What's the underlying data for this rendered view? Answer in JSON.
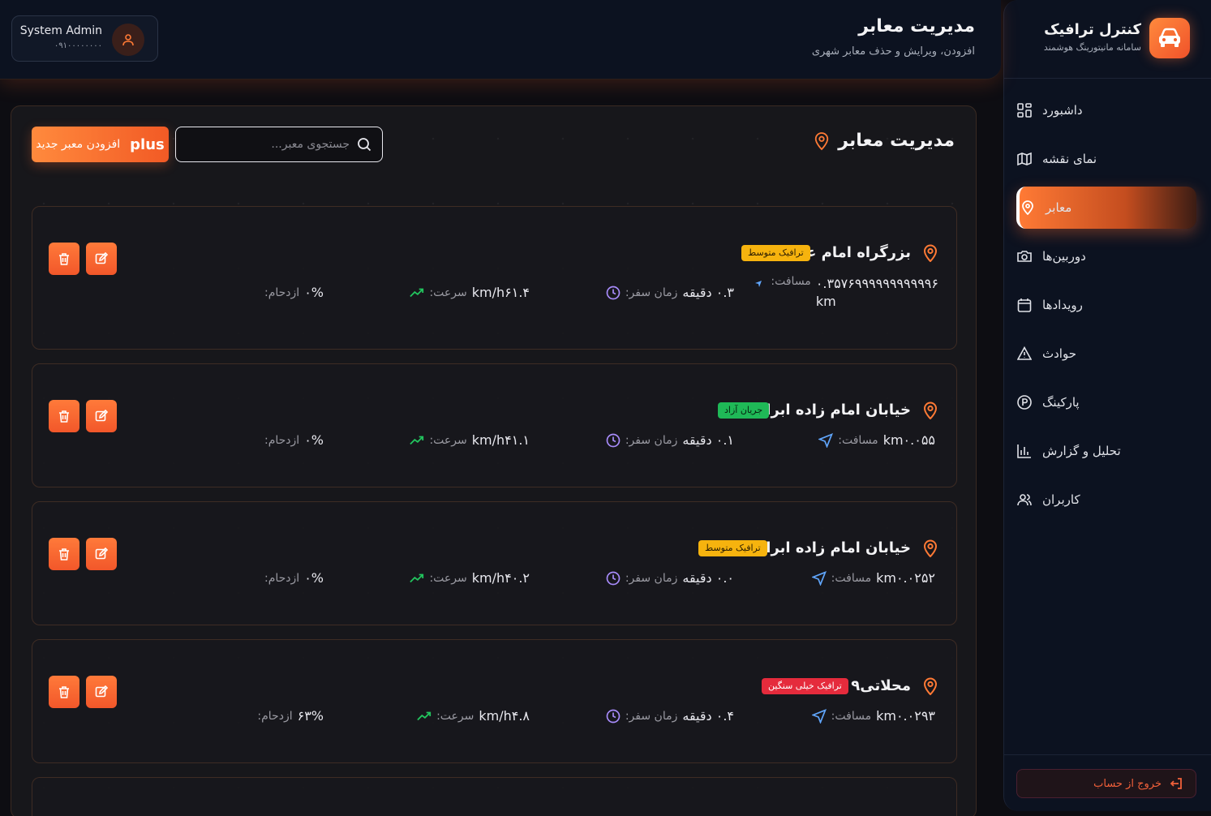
{
  "brand": {
    "title": "کنترل ترافیک",
    "subtitle": "سامانه مانیتورینگ هوشمند"
  },
  "nav": {
    "items": [
      {
        "label": "داشبورد",
        "icon": "dashboard-icon"
      },
      {
        "label": "نمای نقشه",
        "icon": "map-icon"
      },
      {
        "label": "معابر",
        "icon": "map-pin-icon",
        "active": true
      },
      {
        "label": "دوربین‌ها",
        "icon": "camera-icon"
      },
      {
        "label": "رویدادها",
        "icon": "calendar-icon"
      },
      {
        "label": "حوادث",
        "icon": "warning-icon"
      },
      {
        "label": "پارکینگ",
        "icon": "parking-icon"
      },
      {
        "label": "تحلیل و گزارش",
        "icon": "bar-chart-icon"
      },
      {
        "label": "کاربران",
        "icon": "users-icon"
      }
    ],
    "logout_label": "خروج از حساب"
  },
  "header": {
    "title": "مدیریت معابر",
    "subtitle": "افزودن، ویرایش و حذف معابر شهری"
  },
  "user": {
    "name": "System Admin",
    "phone": "۰۹۱۰۰۰۰۰۰۰۰"
  },
  "panel": {
    "title": "مدیریت معابر",
    "search_placeholder": "جستجوی معبر...",
    "add_button_label": "افزودن معبر جدید",
    "add_button_icon": "plus"
  },
  "labels": {
    "distance": "مسافت:",
    "travel_time": "زمان سفر:",
    "speed": "سرعت:",
    "congestion": "ازدحام:"
  },
  "colors": {
    "accent": "#ff7a35",
    "badge_medium": "#f6b30e",
    "badge_free": "#1fb957",
    "badge_heavy": "#e52b3c",
    "speed_icon": "#22c55e",
    "time_icon": "#a78bfa",
    "distance_icon": "#60a5fa"
  },
  "roads": [
    {
      "name": "بزرگراه امام علی",
      "status": "ترافیک متوسط",
      "status_type": "medium",
      "distance": "۰.۳۵۷۶۹۹۹۹۹۹۹۹۹۹۹۶",
      "distance_unit": "km",
      "travel_time": "۰.۳ دقیقه",
      "speed": "km/h۶۱.۴",
      "congestion": "۰%"
    },
    {
      "name": "خیابان امام زاده ابراهیم",
      "status": "جریان آزاد",
      "status_type": "free",
      "distance": "km۰.۰۵۵",
      "travel_time": "۰.۱ دقیقه",
      "speed": "km/h۴۱.۱",
      "congestion": "۰%"
    },
    {
      "name": "خیابان امام زاده ابراهیم",
      "status": "ترافیک متوسط",
      "status_type": "medium",
      "distance": "km۰.۰۲۵۲",
      "travel_time": "۰.۰ دقیقه",
      "speed": "km/h۴۰.۲",
      "congestion": "۰%"
    },
    {
      "name": "محلاتی۹",
      "status": "ترافیک خیلی سنگین",
      "status_type": "heavy",
      "distance": "km۰.۰۲۹۳",
      "travel_time": "۰.۴ دقیقه",
      "speed": "km/h۴.۸",
      "congestion": "۶۳%"
    }
  ]
}
